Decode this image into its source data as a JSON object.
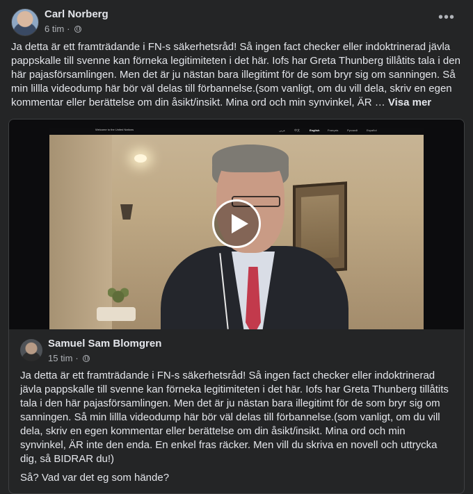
{
  "post": {
    "author": "Carl Norberg",
    "time": "6 tim",
    "privacy_icon": "globe-icon",
    "more_icon": "more-options-icon",
    "text": "Ja detta är ett framträdande i FN-s säkerhetsråd! Så ingen fact checker eller indoktrinerad jävla pappskalle till svenne kan förneka legitimiteten i det här. Iofs har Greta Thunberg tillåtits tala i den här pajasförsamlingen. Men det är ju nästan bara illegitimt för de som bryr sig om sanningen. Så min lillla videodump här bör väl delas till förbannelse.(som vanligt, om du vill dela, skriv en egen kommentar eller berättelse om din åsikt/insikt. Mina ord och min synvinkel, ÄR …",
    "see_more": "Visa mer"
  },
  "video": {
    "overlay_title": "Welcome to the United Nations",
    "languages": [
      "عربي",
      "中文",
      "English",
      "Français",
      "Русский",
      "Español"
    ],
    "play_icon": "play-icon"
  },
  "shared": {
    "author": "Samuel Sam Blomgren",
    "time": "15 tim",
    "privacy_icon": "globe-icon",
    "text": "Ja detta är ett framträdande i FN-s säkerhetsråd! Så ingen fact checker eller indoktrinerad jävla pappskalle till svenne kan förneka legitimiteten i det här. Iofs har Greta Thunberg tillåtits tala i den här pajasförsamlingen. Men det är ju nästan bara illegitimt för de som bryr sig om sanningen. Så min lillla videodump här bör väl delas till förbannelse.(som vanligt, om du vill dela, skriv en egen kommentar eller berättelse om din åsikt/insikt. Mina ord och min synvinkel, ÄR inte den enda. En enkel fras räcker. Men vill du skriva en novell och uttrycka dig, så BIDRAR du!)",
    "text2": "Så? Vad var det eg som hände?"
  },
  "colors": {
    "background": "#242526",
    "text_primary": "#e4e6eb",
    "text_secondary": "#b0b3b8",
    "border": "#3e4042"
  }
}
